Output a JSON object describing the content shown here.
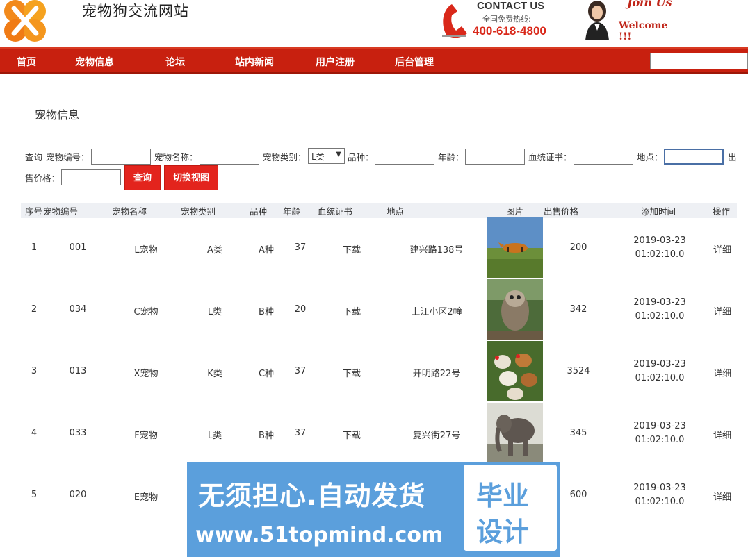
{
  "header": {
    "site_title": "宠物狗交流网站",
    "contact_title": "CONTACT US",
    "contact_sub": "全国免费热线:",
    "contact_phone": "400-618-4800",
    "join_title": "Join Us",
    "join_sub": "Welcome !!!"
  },
  "nav": {
    "items": [
      "首页",
      "宠物信息",
      "论坛",
      "站内新闻",
      "用户注册",
      "后台管理"
    ]
  },
  "panel": {
    "title": "宠物信息"
  },
  "filter": {
    "query_label": "查询",
    "pet_no_label": "宠物编号：",
    "pet_name_label": "宠物名称：",
    "category_label": "宠物类别：",
    "category_value": "L类",
    "breed_label": "品种：",
    "age_label": "年龄：",
    "cert_label": "血统证书：",
    "location_label": "地点：",
    "price_label_a": "出",
    "price_label_b": "售价格：",
    "search_button": "查询",
    "switch_button": "切换视图"
  },
  "table": {
    "headers": [
      "序号",
      "宠物编号",
      "宠物名称",
      "宠物类别",
      "品种",
      "年龄",
      "血统证书",
      "地点",
      "图片",
      "出售价格",
      "添加时间",
      "操作"
    ],
    "rows": [
      {
        "idx": "1",
        "no": "001",
        "name": "L宠物",
        "cat": "A类",
        "breed": "A种",
        "age": "37",
        "cert": "下载",
        "loc": "建兴路138号",
        "price": "200",
        "date": "2019-03-23",
        "time": "01:02:10.0",
        "op": "详细",
        "pic": "tiger"
      },
      {
        "idx": "2",
        "no": "034",
        "name": "C宠物",
        "cat": "L类",
        "breed": "B种",
        "age": "20",
        "cert": "下载",
        "loc": "上江小区2幢",
        "price": "342",
        "date": "2019-03-23",
        "time": "01:02:10.0",
        "op": "详细",
        "pic": "owl"
      },
      {
        "idx": "3",
        "no": "013",
        "name": "X宠物",
        "cat": "K类",
        "breed": "C种",
        "age": "37",
        "cert": "下载",
        "loc": "开明路22号",
        "price": "3524",
        "date": "2019-03-23",
        "time": "01:02:10.0",
        "op": "详细",
        "pic": "chickens"
      },
      {
        "idx": "4",
        "no": "033",
        "name": "F宠物",
        "cat": "L类",
        "breed": "B种",
        "age": "37",
        "cert": "下载",
        "loc": "复兴街27号",
        "price": "345",
        "date": "2019-03-23",
        "time": "01:02:10.0",
        "op": "详细",
        "pic": "elephant"
      },
      {
        "idx": "5",
        "no": "020",
        "name": "E宠物",
        "cat": "",
        "breed": "",
        "age": "",
        "cert": "",
        "loc": "",
        "price": "600",
        "date": "2019-03-23",
        "time": "01:02:10.0",
        "op": "详细",
        "pic": ""
      }
    ]
  },
  "watermark": {
    "line1": "无须担心.自动发货",
    "line2": "www.51topmind.com",
    "box1": "毕业",
    "box2": "设计"
  },
  "colors": {
    "nav_red": "#c8200f",
    "button_red": "#e3241d",
    "watermark_blue": "#5b9fdc",
    "price_red": "#d9281a"
  }
}
